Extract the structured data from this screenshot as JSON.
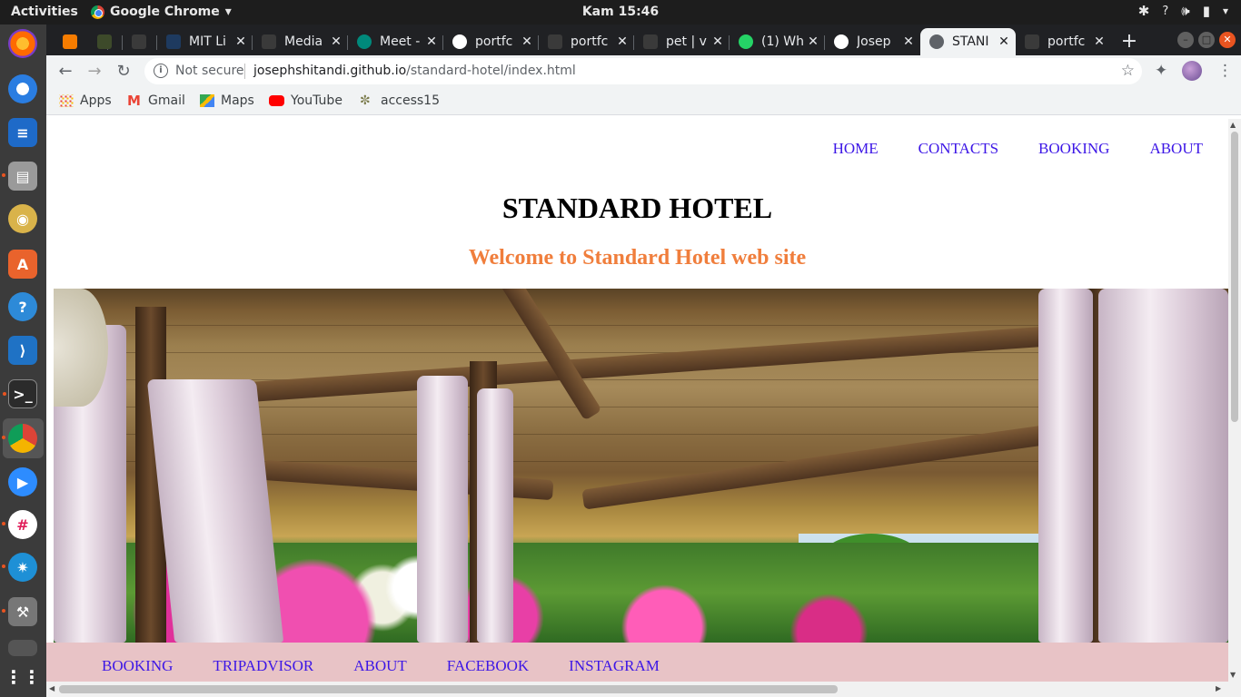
{
  "system": {
    "activities": "Activities",
    "app_name": "Google Chrome",
    "clock": "Kam 15:46",
    "tray_icons": [
      "slack-icon",
      "help-icon",
      "volume-icon",
      "battery-icon"
    ]
  },
  "dock": {
    "items": [
      "firefox-icon",
      "thunderbird-icon",
      "writer-icon",
      "files-icon",
      "rhythmbox-icon",
      "software-icon",
      "help-icon",
      "vscode-icon",
      "terminal-icon",
      "chrome-icon",
      "zoom-icon",
      "slack-icon",
      "settings-icon",
      "tools-icon",
      "drive-icon",
      "show-apps-icon"
    ]
  },
  "browser": {
    "tabs": [
      {
        "title": "",
        "favicon_color": "#f57c00"
      },
      {
        "title": "",
        "favicon_color": "#3d4a2a"
      },
      {
        "title": "",
        "favicon_color": "#3a3a3a"
      },
      {
        "title": "MIT Li",
        "favicon_color": "#1e3a5f"
      },
      {
        "title": "Media",
        "favicon_color": "#3a3a3a"
      },
      {
        "title": "Meet -",
        "favicon_color": "#00897b"
      },
      {
        "title": "portfc",
        "favicon_color": "#ffffff"
      },
      {
        "title": "portfc",
        "favicon_color": "#3a3a3a"
      },
      {
        "title": "pet | v",
        "favicon_color": "#3a3a3a"
      },
      {
        "title": "(1) Wh",
        "favicon_color": "#25d366"
      },
      {
        "title": "Josep",
        "favicon_color": "#ffffff"
      },
      {
        "title": "STANI",
        "favicon_color": "#5f6368"
      },
      {
        "title": "portfc",
        "favicon_color": "#3a3a3a"
      }
    ],
    "new_tab": "+",
    "security_label": "Not secure",
    "url_host": "josephshitandi.github.io",
    "url_path": "/standard-hotel/index.html",
    "bookmarks": [
      {
        "label": "Apps",
        "icon": "apps-grid-icon"
      },
      {
        "label": "Gmail",
        "icon": "gmail-icon"
      },
      {
        "label": "Maps",
        "icon": "maps-icon"
      },
      {
        "label": "YouTube",
        "icon": "youtube-icon"
      },
      {
        "label": "access15",
        "icon": "access15-icon"
      }
    ]
  },
  "page": {
    "top_nav": [
      "HOME",
      "CONTACTS",
      "BOOKING",
      "ABOUT"
    ],
    "title": "STANDARD HOTEL",
    "subtitle": "Welcome to Standard Hotel web site",
    "hero_image": "hotel-gazebo-thatched-roof",
    "bottom_nav": [
      "BOOKING",
      "TRIPADVISOR",
      "ABOUT",
      "FACEBOOK",
      "INSTAGRAM"
    ],
    "colors": {
      "link": "#3c16e6",
      "subtitle": "#f07e3c",
      "footer_bg": "#e8c3c6"
    }
  }
}
